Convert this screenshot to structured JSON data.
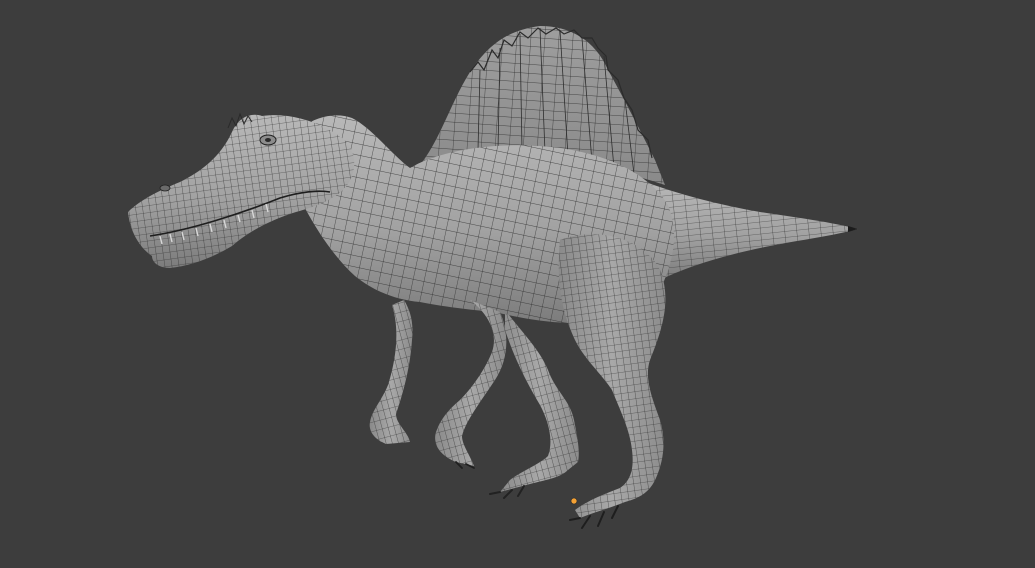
{
  "viewport": {
    "background_color": "#3d3d3d",
    "shading": "solid",
    "overlay": "wireframe"
  },
  "model": {
    "subject": "spinosaurus",
    "surface_color": "#a4a4a4",
    "wire_color": "#242424"
  },
  "origin_point": {
    "color": "#f4a134"
  }
}
